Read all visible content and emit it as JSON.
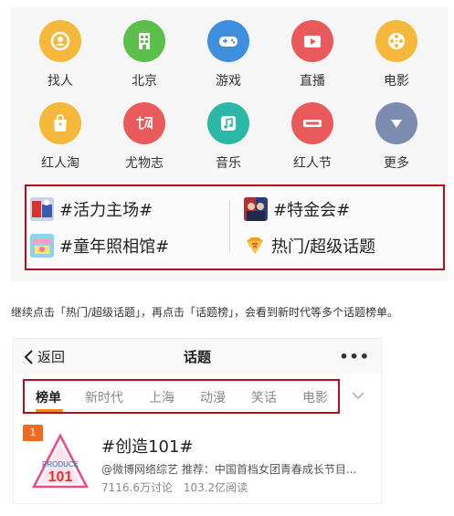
{
  "icons": [
    {
      "label": "找人",
      "icon": "find-people-icon",
      "color": "#f5b83a"
    },
    {
      "label": "北京",
      "icon": "city-building-icon",
      "color": "#5bbf4a"
    },
    {
      "label": "游戏",
      "icon": "gamepad-icon",
      "color": "#3e8fde"
    },
    {
      "label": "直播",
      "icon": "live-video-icon",
      "color": "#eb5a5a"
    },
    {
      "label": "电影",
      "icon": "film-reel-icon",
      "color": "#f5b83a"
    },
    {
      "label": "红人淘",
      "icon": "shopping-bag-icon",
      "color": "#f5b83a"
    },
    {
      "label": "尤物志",
      "icon": "youwu-logo-icon",
      "color": "#eb5a5a"
    },
    {
      "label": "音乐",
      "icon": "music-note-icon",
      "color": "#2cb8a6"
    },
    {
      "label": "红人节",
      "icon": "hongrenjie-logo-icon",
      "color": "#eb5a5a"
    },
    {
      "label": "更多",
      "icon": "chevron-down-icon",
      "color": "#7c8bb0"
    }
  ],
  "topics": {
    "row1_left": "#活力主场#",
    "row1_right": "#特金会#",
    "row2_left": "#童年照相馆#",
    "row2_right": "热门/超级话题"
  },
  "caption": "继续点击「热门/超级话题」，再点击「话题榜」，会看到新时代等多个话题榜单。",
  "nav": {
    "back_label": "返回",
    "title": "话题",
    "more_label": "•••"
  },
  "tabs": [
    "榜单",
    "新时代",
    "上海",
    "动漫",
    "笑话",
    "电影"
  ],
  "active_tab": "榜单",
  "card": {
    "rank": "1",
    "title": "#创造101#",
    "description": "@微博网络综艺 推荐：中国首档女团青春成长节目...",
    "discussions": "7116.6万讨论",
    "reads": "103.2亿阅读",
    "cover_text_top": "PRODUCE",
    "cover_text_main": "101"
  },
  "colors": {
    "highlight_border": "#b40f1b",
    "active_tab_underline": "#f08a1c",
    "rank_badge": "#f06a20"
  }
}
